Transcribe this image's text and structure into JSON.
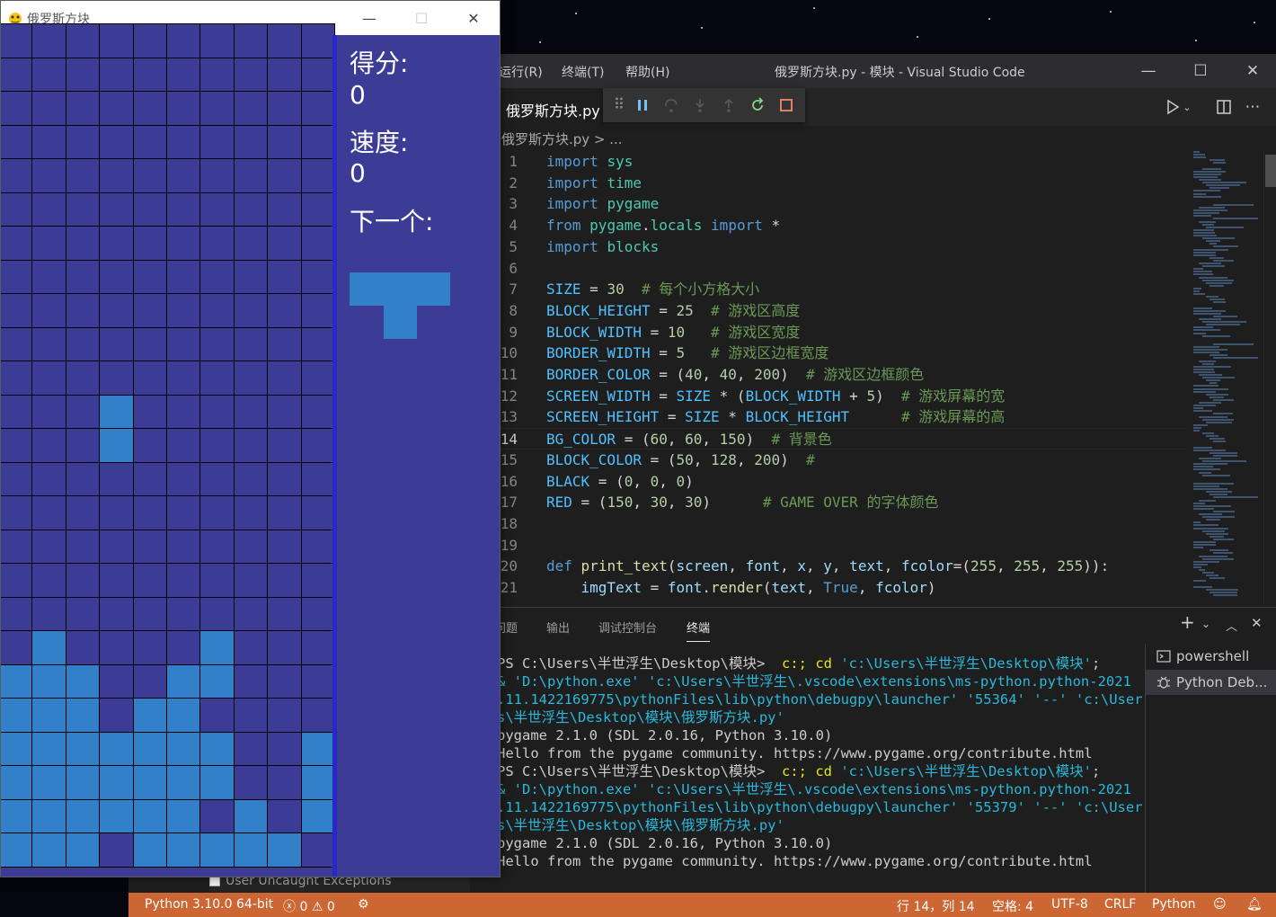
{
  "pygame_window": {
    "title": "俄罗斯方块",
    "score_label": "得分:",
    "score_value": "0",
    "speed_label": "速度:",
    "speed_value": "0",
    "next_label": "下一个:",
    "colors": {
      "bg": "#3c3c96",
      "block": "#3280c8",
      "border": "#2828c8"
    },
    "board": {
      "columns": 10,
      "rows": 25,
      "filled": [
        [
          11,
          3
        ],
        [
          12,
          3
        ],
        [
          18,
          1
        ],
        [
          18,
          6
        ],
        [
          19,
          0
        ],
        [
          19,
          1
        ],
        [
          19,
          2
        ],
        [
          19,
          5
        ],
        [
          19,
          6
        ],
        [
          20,
          0
        ],
        [
          20,
          1
        ],
        [
          20,
          2
        ],
        [
          20,
          4
        ],
        [
          20,
          5
        ],
        [
          21,
          0
        ],
        [
          21,
          1
        ],
        [
          21,
          2
        ],
        [
          21,
          3
        ],
        [
          21,
          4
        ],
        [
          21,
          5
        ],
        [
          21,
          6
        ],
        [
          21,
          9
        ],
        [
          22,
          0
        ],
        [
          22,
          1
        ],
        [
          22,
          2
        ],
        [
          22,
          3
        ],
        [
          22,
          4
        ],
        [
          22,
          5
        ],
        [
          22,
          6
        ],
        [
          22,
          9
        ],
        [
          23,
          0
        ],
        [
          23,
          1
        ],
        [
          23,
          2
        ],
        [
          23,
          3
        ],
        [
          23,
          4
        ],
        [
          23,
          5
        ],
        [
          23,
          7
        ],
        [
          23,
          9
        ],
        [
          24,
          0
        ],
        [
          24,
          1
        ],
        [
          24,
          2
        ],
        [
          24,
          4
        ],
        [
          24,
          5
        ],
        [
          24,
          6
        ],
        [
          24,
          7
        ],
        [
          24,
          8
        ]
      ]
    }
  },
  "vscode": {
    "menu": [
      "运行(R)",
      "终端(T)",
      "帮助(H)"
    ],
    "title": "俄罗斯方块.py - 模块 - Visual Studio Code",
    "tab_label": "俄罗斯方块.py",
    "breadcrumb": "俄罗斯方块.py > ...",
    "debug_toolbar": [
      "drag-handle",
      "pause",
      "step-over",
      "step-into",
      "step-out",
      "restart",
      "stop"
    ],
    "code": [
      {
        "n": "1",
        "t": "import sys"
      },
      {
        "n": "2",
        "t": "import time"
      },
      {
        "n": "3",
        "t": "import pygame"
      },
      {
        "n": "4",
        "t": "from pygame.locals import *"
      },
      {
        "n": "5",
        "t": "import blocks"
      },
      {
        "n": "6",
        "t": ""
      },
      {
        "n": "7",
        "t": "SIZE = 30  # 每个小方格大小"
      },
      {
        "n": "8",
        "t": "BLOCK_HEIGHT = 25  # 游戏区高度"
      },
      {
        "n": "9",
        "t": "BLOCK_WIDTH = 10   # 游戏区宽度"
      },
      {
        "n": "10",
        "t": "BORDER_WIDTH = 5   # 游戏区边框宽度"
      },
      {
        "n": "11",
        "t": "BORDER_COLOR = (40, 40, 200)  # 游戏区边框颜色"
      },
      {
        "n": "12",
        "t": "SCREEN_WIDTH = SIZE * (BLOCK_WIDTH + 5)  # 游戏屏幕的宽"
      },
      {
        "n": "13",
        "t": "SCREEN_HEIGHT = SIZE * BLOCK_HEIGHT      # 游戏屏幕的高"
      },
      {
        "n": "14",
        "t": "BG_COLOR = (60, 60, 150)  # 背景色"
      },
      {
        "n": "15",
        "t": "BLOCK_COLOR = (50, 128, 200)  #"
      },
      {
        "n": "16",
        "t": "BLACK = (0, 0, 0)"
      },
      {
        "n": "17",
        "t": "RED = (150, 30, 30)      # GAME OVER 的字体颜色"
      },
      {
        "n": "18",
        "t": ""
      },
      {
        "n": "19",
        "t": ""
      },
      {
        "n": "20",
        "t": "def print_text(screen, font, x, y, text, fcolor=(255, 255, 255)):"
      },
      {
        "n": "21",
        "t": "    imgText = font.render(text, True, fcolor)"
      }
    ],
    "panel_tabs": [
      "问题",
      "输出",
      "调试控制台",
      "终端"
    ],
    "terminal_lines": [
      "PS C:\\Users\\半世浮生\\Desktop\\模块>  c:; cd 'c:\\Users\\半世浮生\\Desktop\\模块';",
      "& 'D:\\python.exe' 'c:\\Users\\半世浮生\\.vscode\\extensions\\ms-python.python-2021",
      ".11.1422169775\\pythonFiles\\lib\\python\\debugpy\\launcher' '55364' '--' 'c:\\User",
      "s\\半世浮生\\Desktop\\模块\\俄罗斯方块.py'",
      "pygame 2.1.0 (SDL 2.0.16, Python 3.10.0)",
      "Hello from the pygame community. https://www.pygame.org/contribute.html",
      "PS C:\\Users\\半世浮生\\Desktop\\模块>  c:; cd 'c:\\Users\\半世浮生\\Desktop\\模块';",
      "& 'D:\\python.exe' 'c:\\Users\\半世浮生\\.vscode\\extensions\\ms-python.python-2021",
      ".11.1422169775\\pythonFiles\\lib\\python\\debugpy\\launcher' '55379' '--' 'c:\\User",
      "s\\半世浮生\\Desktop\\模块\\俄罗斯方块.py'",
      "pygame 2.1.0 (SDL 2.0.16, Python 3.10.0)",
      "Hello from the pygame community. https://www.pygame.org/contribute.html"
    ],
    "terminal_instances": [
      "powershell",
      "Python Deb..."
    ],
    "behind_text": "User Uncaught Exceptions",
    "status": {
      "python": "Python 3.10.0 64-bit",
      "errors": "0",
      "warnings": "0",
      "position": "行 14，列 14",
      "spaces": "空格: 4",
      "encoding": "UTF-8",
      "eol": "CRLF",
      "language": "Python",
      "color": "#cc6633"
    }
  }
}
